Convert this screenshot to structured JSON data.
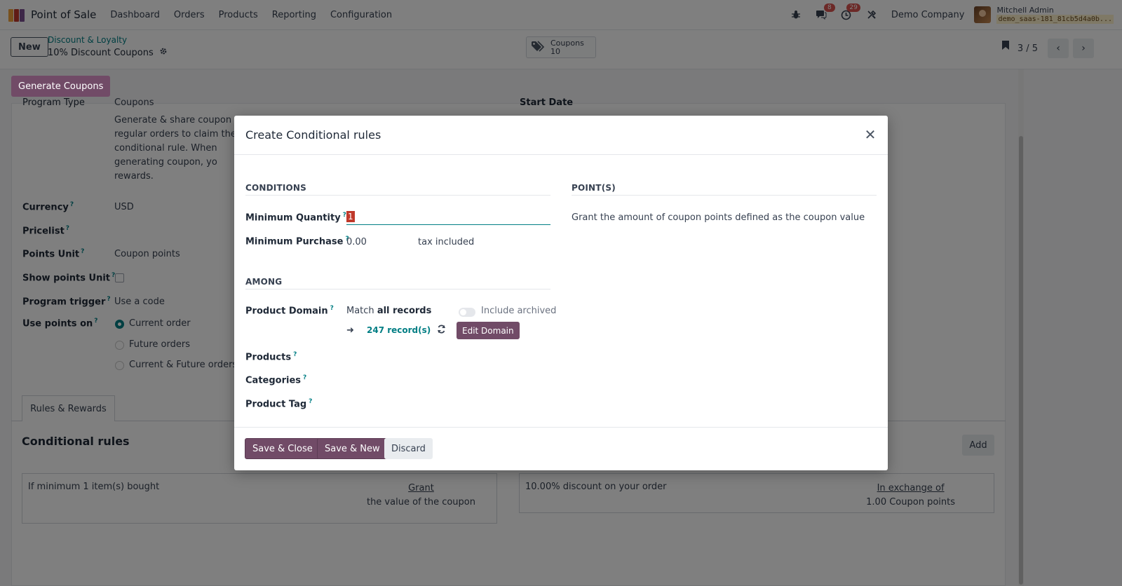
{
  "navbar": {
    "app_name": "Point of Sale",
    "menu": [
      "Dashboard",
      "Orders",
      "Products",
      "Reporting",
      "Configuration"
    ],
    "messages_count": "8",
    "activities_count": "29",
    "company": "Demo Company",
    "user_name": "Mitchell Admin",
    "database": "demo_saas-181_81cb5d4a0b..."
  },
  "control": {
    "new_label": "New",
    "breadcrumb_parent": "Discount & Loyalty",
    "breadcrumb_current": "10% Discount Coupons",
    "smart_button_label": "Coupons",
    "smart_button_count": "10",
    "pager": "3 / 5"
  },
  "form": {
    "generate_label": "Generate Coupons",
    "program_type_label": "Program Type",
    "program_type_value": "Coupons",
    "start_date_label": "Start Date",
    "description": "Generate & share coupon co regular orders to claim the R conditional rule. When generating coupon, yo rewards.",
    "currency_label": "Currency",
    "currency_value": "USD",
    "pricelist_label": "Pricelist",
    "points_unit_label": "Points Unit",
    "points_unit_value": "Coupon points",
    "show_points_label": "Show points Unit",
    "trigger_label": "Program trigger",
    "trigger_value": "Use a code",
    "use_points_label": "Use points on",
    "use_points_options": [
      "Current order",
      "Future orders",
      "Current & Future orders"
    ],
    "tab_label": "Rules & Rewards",
    "section_title": "Conditional rules",
    "add_label": "Add",
    "rule_card": {
      "text": "If minimum 1 item(s) bought",
      "right_title": "Grant",
      "right_text": "the value of the coupon"
    },
    "reward_card": {
      "text": "10.00% discount on your order",
      "right_title": "In exchange of",
      "right_text": "1.00 Coupon points"
    }
  },
  "modal": {
    "title": "Create Conditional rules",
    "conditions_title": "CONDITIONS",
    "points_title": "POINT(S)",
    "min_qty_label": "Minimum Quantity",
    "min_qty_value": "1",
    "min_purchase_label": "Minimum Purchase",
    "min_purchase_value": "0.00",
    "tax_label": "tax included",
    "points_text": "Grant the amount of coupon points defined as the coupon value",
    "among_title": "AMONG",
    "product_domain_label": "Product Domain",
    "match_prefix": "Match",
    "match_value": "all records",
    "include_archived": "Include archived",
    "records_link": "247 record(s)",
    "edit_domain": "Edit Domain",
    "products_label": "Products",
    "categories_label": "Categories",
    "product_tag_label": "Product Tag",
    "save_close": "Save & Close",
    "save_new": "Save & New",
    "discard": "Discard"
  },
  "colors": {
    "primary": "#714b67",
    "link": "#017e84",
    "badge": "#d9534f"
  }
}
